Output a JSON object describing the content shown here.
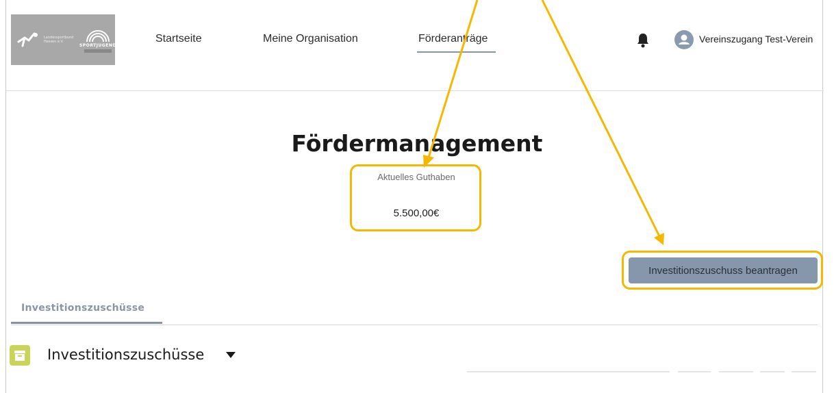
{
  "brand": {
    "left_text": "Landessportbund Hessen e.V.",
    "right_text": "SPORTJUGEND"
  },
  "nav": {
    "items": [
      {
        "label": "Startseite"
      },
      {
        "label": "Meine Organisation"
      },
      {
        "label": "Förderanträge",
        "active": true
      }
    ]
  },
  "user": {
    "name": "Vereinszugang Test-Verein"
  },
  "page": {
    "title": "Fördermanagement",
    "balance_label": "Aktuelles Guthaben",
    "balance_value": "5.500,00€"
  },
  "actions": {
    "invest_button": "Investitionszuschuss beantragen"
  },
  "tabs": [
    {
      "label": "Investitionszuschüsse",
      "active": true
    }
  ],
  "list": {
    "title": "Investitionszuschüsse"
  },
  "icons": [
    "bell-icon",
    "user-avatar-icon",
    "archive-icon",
    "caret-down-icon"
  ],
  "colors": {
    "highlight": "#f5b800",
    "accent": "#8494a8",
    "button_bg": "#8797ab",
    "list_icon": "#c9d45a",
    "logo_bg": "#a8a8a8"
  }
}
